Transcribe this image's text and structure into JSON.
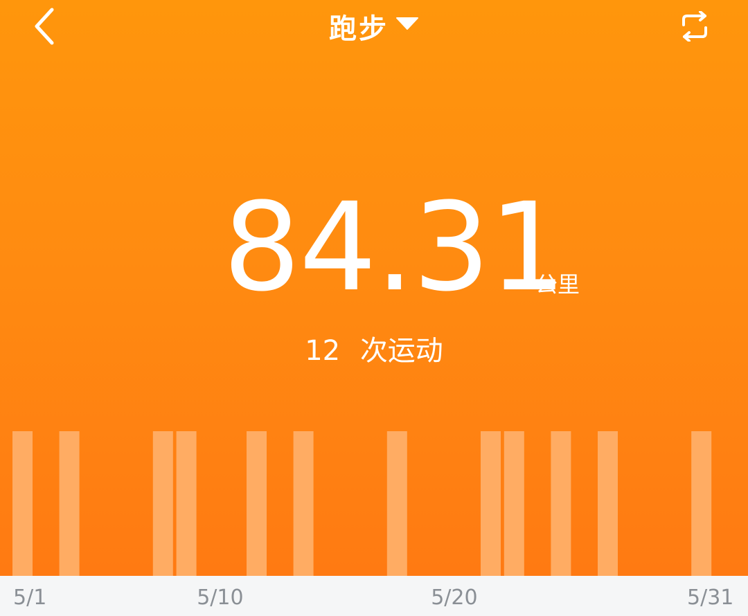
{
  "header": {
    "title": "跑步",
    "back_icon": "chevron-left-icon",
    "dropdown_icon": "caret-down-icon",
    "swap_icon": "repeat-icon"
  },
  "summary": {
    "distance": "84.31",
    "unit": "公里",
    "count": "12",
    "count_label": "次运动"
  },
  "colors": {
    "accent_top": "#ff960c",
    "accent_bottom": "#ff7a12",
    "bar": "#ffb06a",
    "axis_text": "#8a8f95"
  },
  "chart_data": {
    "type": "bar",
    "x_range": [
      1,
      31
    ],
    "active_days": [
      1,
      3,
      7,
      8,
      11,
      13,
      17,
      21,
      22,
      24,
      26,
      30
    ],
    "tick_labels": [
      "5/1",
      "5/10",
      "5/20",
      "5/31"
    ],
    "tick_days": [
      1,
      10,
      20,
      31
    ]
  }
}
